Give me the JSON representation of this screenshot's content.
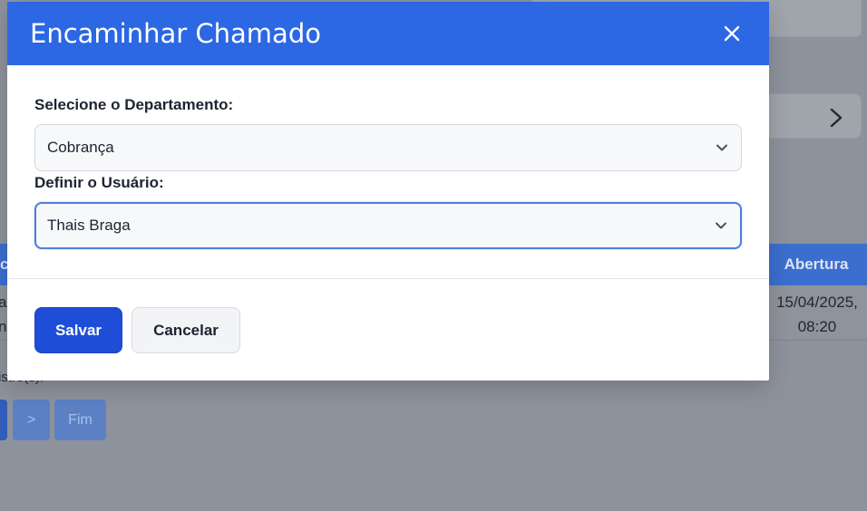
{
  "modal": {
    "title": "Encaminhar Chamado",
    "close_icon": "close-icon",
    "department": {
      "label": "Selecione o Departamento:",
      "value": "Cobrança"
    },
    "user": {
      "label": "Definir o Usuário:",
      "value": "Thais Braga"
    },
    "buttons": {
      "save": "Salvar",
      "cancel": "Cancelar"
    }
  },
  "background": {
    "table_header_partial": "co",
    "column_header": "Abertura",
    "row": {
      "left_line1": "ag",
      "left_line2": "nc",
      "date_line1": "15/04/2025,",
      "date_line2": "08:20"
    },
    "records_text": "istro(s).",
    "pagination": {
      "next": ">",
      "end": "Fim"
    }
  },
  "colors": {
    "header_blue": "#2c67e4",
    "primary_button": "#1e4ed8",
    "overlay": "#8e929c"
  }
}
